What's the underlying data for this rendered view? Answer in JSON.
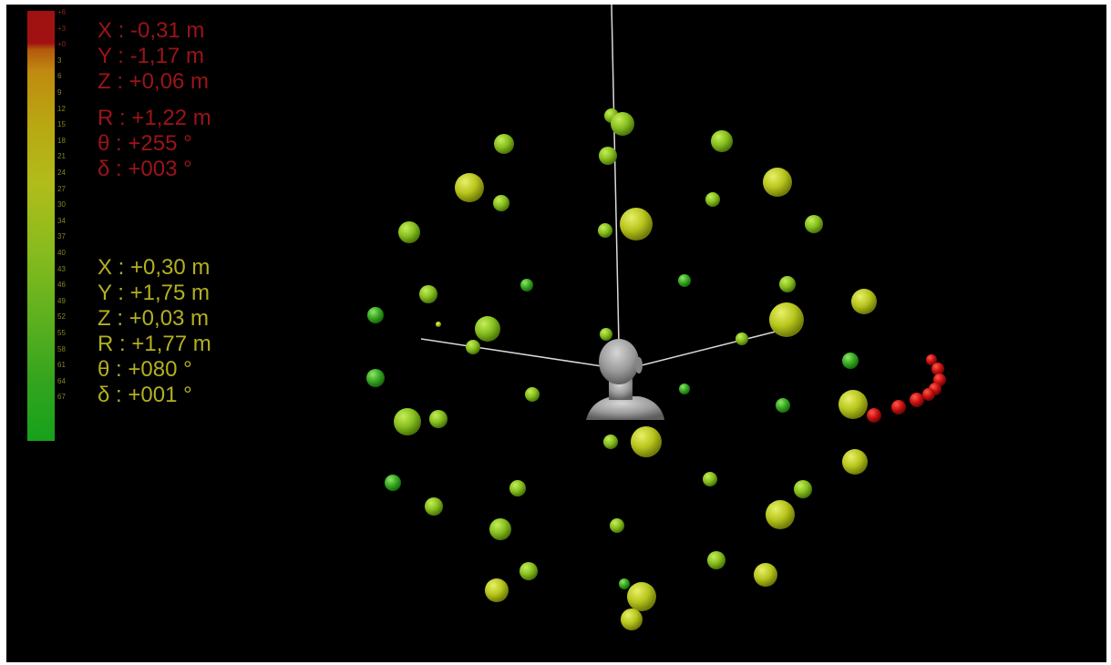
{
  "colors": {
    "background": "#000000",
    "source_text": "#9c1418",
    "listener_text": "#b3b021",
    "axis": "#d9d9d9",
    "head": "#9b9b9b",
    "hot_marker": "#c01010"
  },
  "colorbar": {
    "tick_labels": [
      "+6",
      "+3",
      "+0",
      "3",
      "6",
      "9",
      "12",
      "15",
      "18",
      "21",
      "24",
      "27",
      "30",
      "34",
      "37",
      "40",
      "43",
      "46",
      "49",
      "52",
      "55",
      "58",
      "61",
      "64",
      "67"
    ]
  },
  "source": {
    "x": "X : -0,31 m",
    "y": "Y : -1,17 m",
    "z": "Z : +0,06 m",
    "r": "R : +1,22 m",
    "theta": "θ : +255 °",
    "delta": "δ : +003 °"
  },
  "listener": {
    "x": "X : +0,30 m",
    "y": "Y : +1,75 m",
    "z": "Z : +0,03 m",
    "r": "R : +1,77 m",
    "theta": "θ : +080 °",
    "delta": "δ : +001 °"
  }
}
